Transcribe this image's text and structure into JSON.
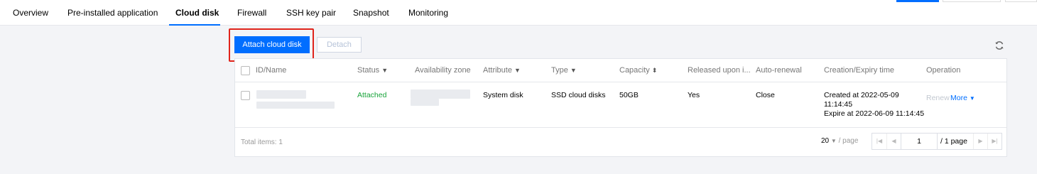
{
  "tabs": [
    {
      "label": "Overview",
      "active": false
    },
    {
      "label": "Pre-installed application",
      "active": false
    },
    {
      "label": "Cloud disk",
      "active": true
    },
    {
      "label": "Firewall",
      "active": false
    },
    {
      "label": "SSH key pair",
      "active": false
    },
    {
      "label": "Snapshot",
      "active": false
    },
    {
      "label": "Monitoring",
      "active": false
    }
  ],
  "actions": {
    "attach_label": "Attach cloud disk",
    "detach_label": "Detach"
  },
  "table": {
    "headers": {
      "id_name": "ID/Name",
      "status": "Status",
      "zone": "Availability zone",
      "attribute": "Attribute",
      "type": "Type",
      "capacity": "Capacity",
      "released": "Released upon i...",
      "auto_renewal": "Auto-renewal",
      "time": "Creation/Expiry time",
      "operation": "Operation"
    },
    "rows": [
      {
        "status": "Attached",
        "attribute": "System disk",
        "type": "SSD cloud disks",
        "capacity": "50GB",
        "released": "Yes",
        "auto_renewal": "Close",
        "created_line1": "Created at 2022-05-09",
        "created_line2": "11:14:45",
        "expire": "Expire at 2022-06-09 11:14:45",
        "renew_label": "Renew",
        "more_label": "More"
      }
    ]
  },
  "footer": {
    "total": "Total items: 1",
    "page_size": "20",
    "page_size_unit": "/ page",
    "current_page": "1",
    "total_pages": "/ 1 page"
  },
  "colors": {
    "accent": "#006eff",
    "status_green": "#18a33a",
    "highlight": "#e0241b"
  }
}
